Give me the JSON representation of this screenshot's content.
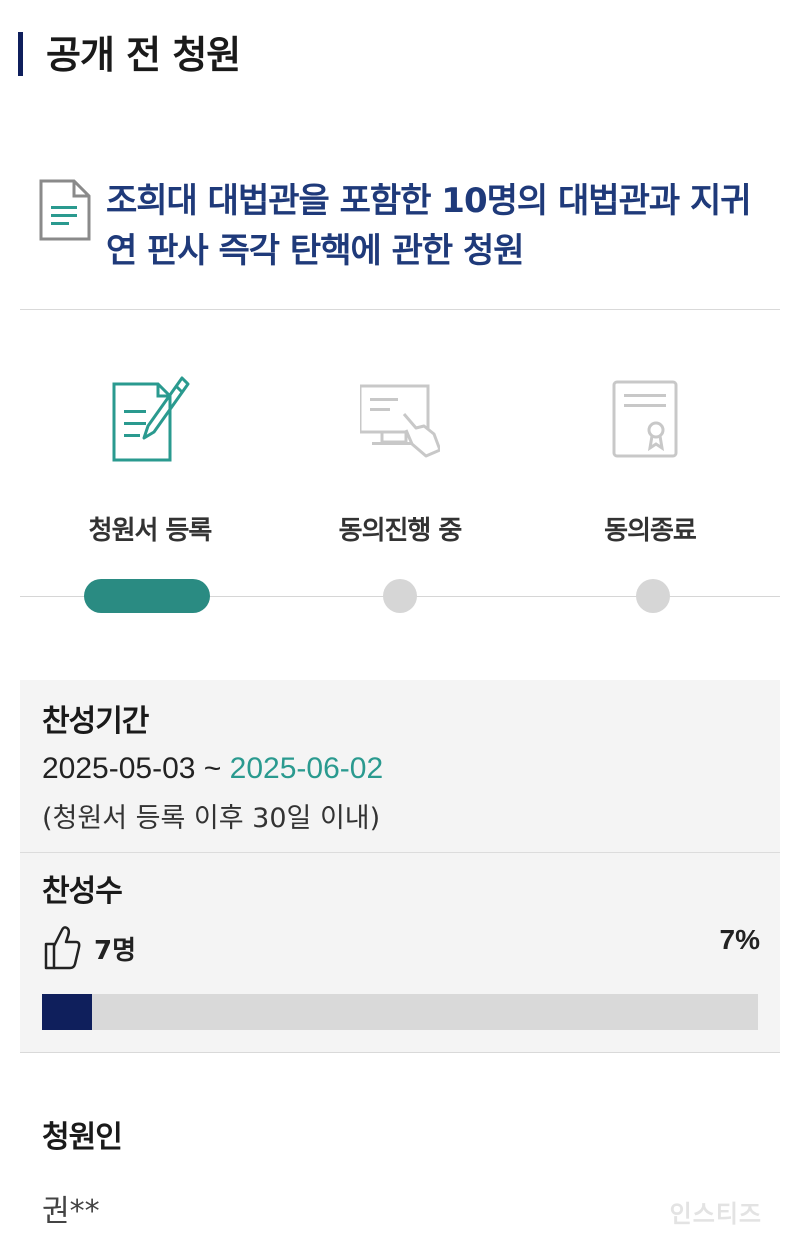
{
  "header": {
    "title": "공개 전 청원"
  },
  "petition": {
    "title": "조희대 대법관을 포함한 10명의 대법관과 지귀연 판사 즉각 탄핵에 관한 청원",
    "icon": "document-icon"
  },
  "steps": [
    {
      "label": "청원서 등록",
      "icon": "document-pen-icon",
      "active": true
    },
    {
      "label": "동의진행 중",
      "icon": "monitor-touch-icon",
      "active": false
    },
    {
      "label": "동의종료",
      "icon": "certificate-icon",
      "active": false
    }
  ],
  "period": {
    "label": "찬성기간",
    "start": "2025-05-03",
    "separator": " ~ ",
    "end": "2025-06-02",
    "note": "(청원서 등록 이후 30일 이내)"
  },
  "votes": {
    "label": "찬성수",
    "count": "7명",
    "percent_text": "7%",
    "progress_fraction": 0.07
  },
  "petitioner": {
    "label": "청원인",
    "name": "권**"
  },
  "watermark": "인스티즈",
  "colors": {
    "accent_navy": "#0f1f5c",
    "teal": "#2a8b82",
    "teal_text": "#2a9a8f",
    "title_blue": "#1f3a7a",
    "inactive_gray": "#d6d6d6"
  }
}
